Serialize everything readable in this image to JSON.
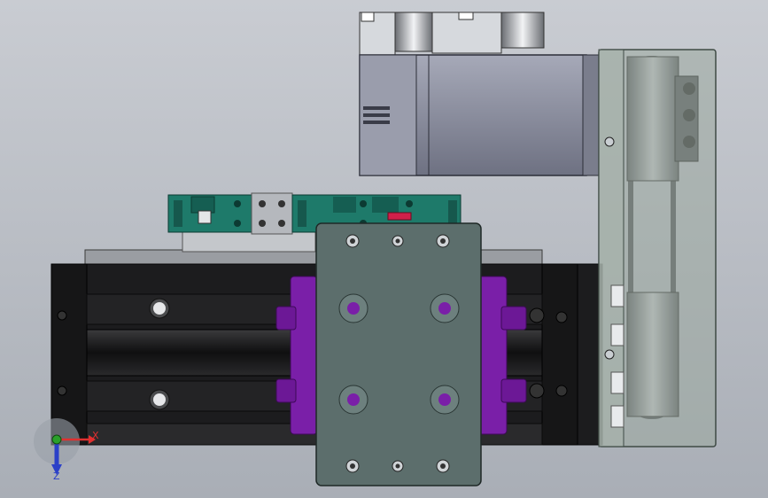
{
  "viewport": {
    "background_top": "#c9ccd2",
    "background_bottom": "#a9aeb6"
  },
  "triad": {
    "x_label": "X",
    "z_label": "Z",
    "x_color": "#e03030",
    "z_color": "#2b40c8",
    "origin_color": "#2aa02a"
  },
  "parts": {
    "rail_body_color": "#1c1c1e",
    "rail_top_color": "#9a9da2",
    "carriage_plate_color": "#5c6e6c",
    "bearing_block_color": "#7a1fa8",
    "valve_color": "#1e7a6a",
    "motor_color": "#8d90a0",
    "belt_cover_color": "#9aa79f",
    "belt_cover_opacity": 0.55,
    "connector_color": "#c8ccd2",
    "accent_red": "#d0204a"
  }
}
